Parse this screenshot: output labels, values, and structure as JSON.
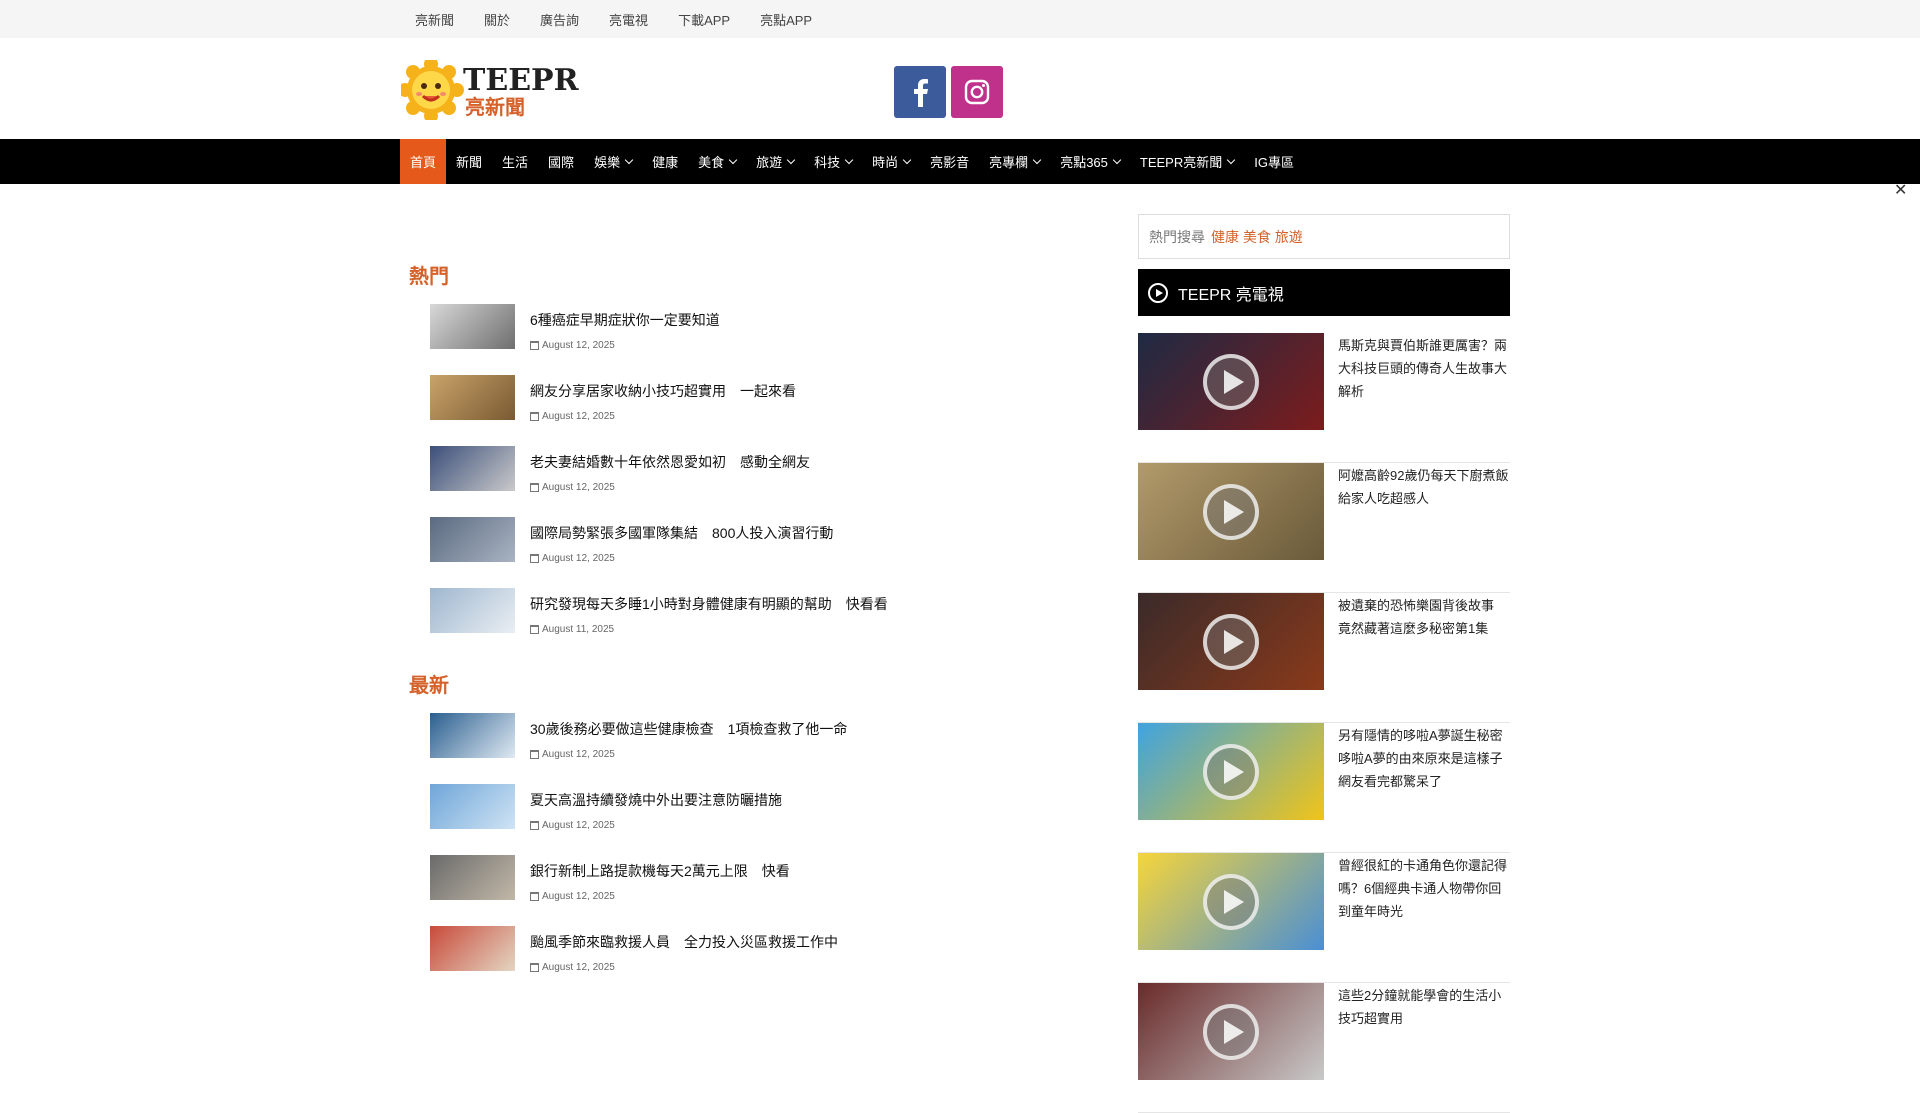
{
  "topbar": {
    "links": [
      "亮新聞",
      "關於",
      "廣告詢",
      "亮電視",
      "下載APP",
      "亮點APP"
    ]
  },
  "header": {
    "logo_text": "TEEPR",
    "logo_subtext": "亮新聞",
    "social": [
      "f",
      "instagram"
    ]
  },
  "nav": {
    "items": [
      {
        "label": "首頁",
        "dropdown": false,
        "active": true
      },
      {
        "label": "新聞",
        "dropdown": false
      },
      {
        "label": "生活",
        "dropdown": false
      },
      {
        "label": "國際",
        "dropdown": false
      },
      {
        "label": "娛樂",
        "dropdown": true
      },
      {
        "label": "健康",
        "dropdown": false
      },
      {
        "label": "美食",
        "dropdown": true
      },
      {
        "label": "旅遊",
        "dropdown": true
      },
      {
        "label": "科技",
        "dropdown": true
      },
      {
        "label": "時尚",
        "dropdown": true
      },
      {
        "label": "亮影音",
        "dropdown": false
      },
      {
        "label": "亮專欄",
        "dropdown": true
      },
      {
        "label": "亮點365",
        "dropdown": true
      },
      {
        "label": "TEEPR亮新聞",
        "dropdown": true
      },
      {
        "label": "IG專區",
        "dropdown": false
      }
    ]
  },
  "sections": [
    {
      "title": "熱門",
      "articles": [
        {
          "title": "6種癌症早期症狀你一定要知道",
          "date": "August 12, 2025",
          "thumb": [
            "#d8d8d8",
            "#6e6e6e"
          ]
        },
        {
          "title": "網友分享居家收納小技巧超實用　一起來看",
          "date": "August 12, 2025",
          "thumb": [
            "#c9a36a",
            "#7a5a32"
          ]
        },
        {
          "title": "老夫妻結婚數十年依然恩愛如初　感動全網友",
          "date": "August 12, 2025",
          "thumb": [
            "#3b4f7a",
            "#c9c9c9"
          ]
        },
        {
          "title": "國際局勢緊張多國軍隊集結　800人投入演習行動",
          "date": "August 12, 2025",
          "thumb": [
            "#5a6a80",
            "#a9b3c2"
          ]
        },
        {
          "title": "研究發現每天多睡1小時對身體健康有明顯的幫助　快看看",
          "date": "August 11, 2025",
          "thumb": [
            "#9fb7cf",
            "#e9eef3"
          ]
        }
      ]
    },
    {
      "title": "最新",
      "articles": [
        {
          "title": "30歲後務必要做這些健康檢查　1項檢查救了他一命",
          "date": "August 12, 2025",
          "thumb": [
            "#2b5f8f",
            "#dfe9f2"
          ]
        },
        {
          "title": "夏天高溫持續發燒中外出要注意防曬措施",
          "date": "August 12, 2025",
          "thumb": [
            "#6fa6d8",
            "#cfe3f4"
          ]
        },
        {
          "title": "銀行新制上路提款機每天2萬元上限　快看",
          "date": "August 12, 2025",
          "thumb": [
            "#6a6a6a",
            "#c2b8a8"
          ]
        },
        {
          "title": "颱風季節來臨救援人員　全力投入災區救援工作中",
          "date": "August 12, 2025",
          "thumb": [
            "#c94a3a",
            "#e3d6c2"
          ]
        }
      ]
    }
  ],
  "sidebar": {
    "search_placeholder": "熱門搜尋",
    "hot_keywords": [
      "健康",
      "美食",
      "旅遊"
    ],
    "video_header": "TEEPR 亮電視",
    "videos": [
      {
        "title": "馬斯克與賈伯斯誰更厲害？兩大科技巨頭的傳奇人生故事大解析",
        "thumb": [
          "#1e2a44",
          "#7c1c1c"
        ]
      },
      {
        "title": "阿嬤高齡92歲仍每天下廚煮飯給家人吃超感人",
        "thumb": [
          "#b29a6a",
          "#6a5a3a"
        ]
      },
      {
        "title": "被遺棄的恐怖樂園背後故事　竟然藏著這麼多秘密第1集",
        "thumb": [
          "#3a2a2a",
          "#8a3a1a"
        ]
      },
      {
        "title": "另有隱情的哆啦A夢誕生秘密　哆啦A夢的由來原來是這樣子　網友看完都驚呆了",
        "thumb": [
          "#3fa3e0",
          "#f0c419"
        ]
      },
      {
        "title": "曾經很紅的卡通角色你還記得嗎？6個經典卡通人物帶你回到童年時光",
        "thumb": [
          "#f6d53a",
          "#4a8fd4"
        ]
      },
      {
        "title": "這些2分鐘就能學會的生活小技巧超實用",
        "thumb": [
          "#6a2a2a",
          "#c9c9c9"
        ]
      }
    ]
  },
  "close_label": "✕"
}
